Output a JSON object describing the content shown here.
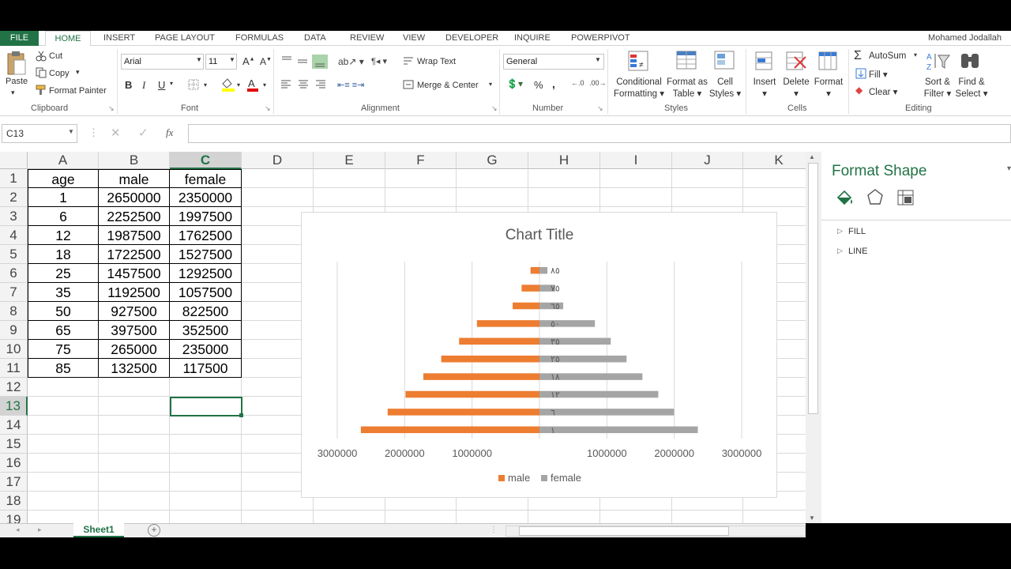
{
  "tabs": {
    "file": "FILE",
    "home": "HOME",
    "insert": "INSERT",
    "page_layout": "PAGE LAYOUT",
    "formulas": "FORMULAS",
    "data": "DATA",
    "review": "REVIEW",
    "view": "VIEW",
    "developer": "DEVELOPER",
    "inquire": "INQUIRE",
    "powerpivot": "POWERPIVOT"
  },
  "user": "Mohamed Jodallah",
  "clipboard": {
    "paste": "Paste",
    "cut": "Cut",
    "copy": "Copy",
    "format_painter": "Format Painter",
    "label": "Clipboard"
  },
  "font": {
    "name": "Arial",
    "size": "11",
    "label": "Font",
    "bold": "B",
    "italic": "I",
    "underline": "U"
  },
  "alignment": {
    "wrap": "Wrap Text",
    "merge": "Merge & Center",
    "label": "Alignment"
  },
  "number": {
    "format": "General",
    "percent": "%",
    "comma": ",",
    "label": "Number"
  },
  "styles": {
    "cond1": "Conditional",
    "cond2": "Formatting",
    "table1": "Format as",
    "table2": "Table",
    "cell1": "Cell",
    "cell2": "Styles",
    "label": "Styles"
  },
  "cells": {
    "insert": "Insert",
    "delete": "Delete",
    "format": "Format",
    "label": "Cells"
  },
  "editing": {
    "autosum": "AutoSum",
    "fill": "Fill",
    "clear": "Clear",
    "sort1": "Sort &",
    "sort2": "Filter",
    "find1": "Find &",
    "find2": "Select",
    "label": "Editing"
  },
  "formula_bar": {
    "name_box": "C13",
    "fx": "fx",
    "value": ""
  },
  "columns": [
    "A",
    "B",
    "C",
    "D",
    "E",
    "F",
    "G",
    "H",
    "I",
    "J",
    "K"
  ],
  "rows": [
    "1",
    "2",
    "3",
    "4",
    "5",
    "6",
    "7",
    "8",
    "9",
    "10",
    "11",
    "12",
    "13",
    "14",
    "15",
    "16",
    "17",
    "18",
    "19"
  ],
  "table": {
    "headers": [
      "age",
      "male",
      "female"
    ],
    "rows": [
      [
        "1",
        "2650000",
        "2350000"
      ],
      [
        "6",
        "2252500",
        "1997500"
      ],
      [
        "12",
        "1987500",
        "1762500"
      ],
      [
        "18",
        "1722500",
        "1527500"
      ],
      [
        "25",
        "1457500",
        "1292500"
      ],
      [
        "35",
        "1192500",
        "1057500"
      ],
      [
        "50",
        "927500",
        "822500"
      ],
      [
        "65",
        "397500",
        "352500"
      ],
      [
        "75",
        "265000",
        "235000"
      ],
      [
        "85",
        "132500",
        "117500"
      ]
    ]
  },
  "pane": {
    "title": "Format Shape",
    "fill": "FILL",
    "line": "LINE"
  },
  "sheet": {
    "name": "Sheet1"
  },
  "colors": {
    "accent": "#217346",
    "male": "#ed7d31",
    "female": "#a5a5a5"
  },
  "chart_data": {
    "type": "bar",
    "title": "Chart Title",
    "orientation": "horizontal",
    "categories": [
      "١",
      "٦",
      "١٢",
      "١٨",
      "٢٥",
      "٣٥",
      "٥٠",
      "٦٥",
      "٧٥",
      "٨٥"
    ],
    "series": [
      {
        "name": "male",
        "values": [
          -2650000,
          -2252500,
          -1987500,
          -1722500,
          -1457500,
          -1192500,
          -927500,
          -397500,
          -265000,
          -132500
        ]
      },
      {
        "name": "female",
        "values": [
          2350000,
          1997500,
          1762500,
          1527500,
          1292500,
          1057500,
          822500,
          352500,
          235000,
          117500
        ]
      }
    ],
    "xlim": [
      -3000000,
      3000000
    ],
    "xticks": [
      "3000000",
      "2000000",
      "1000000",
      "",
      "1000000",
      "2000000",
      "3000000"
    ],
    "legend": "bottom",
    "grid": true
  }
}
